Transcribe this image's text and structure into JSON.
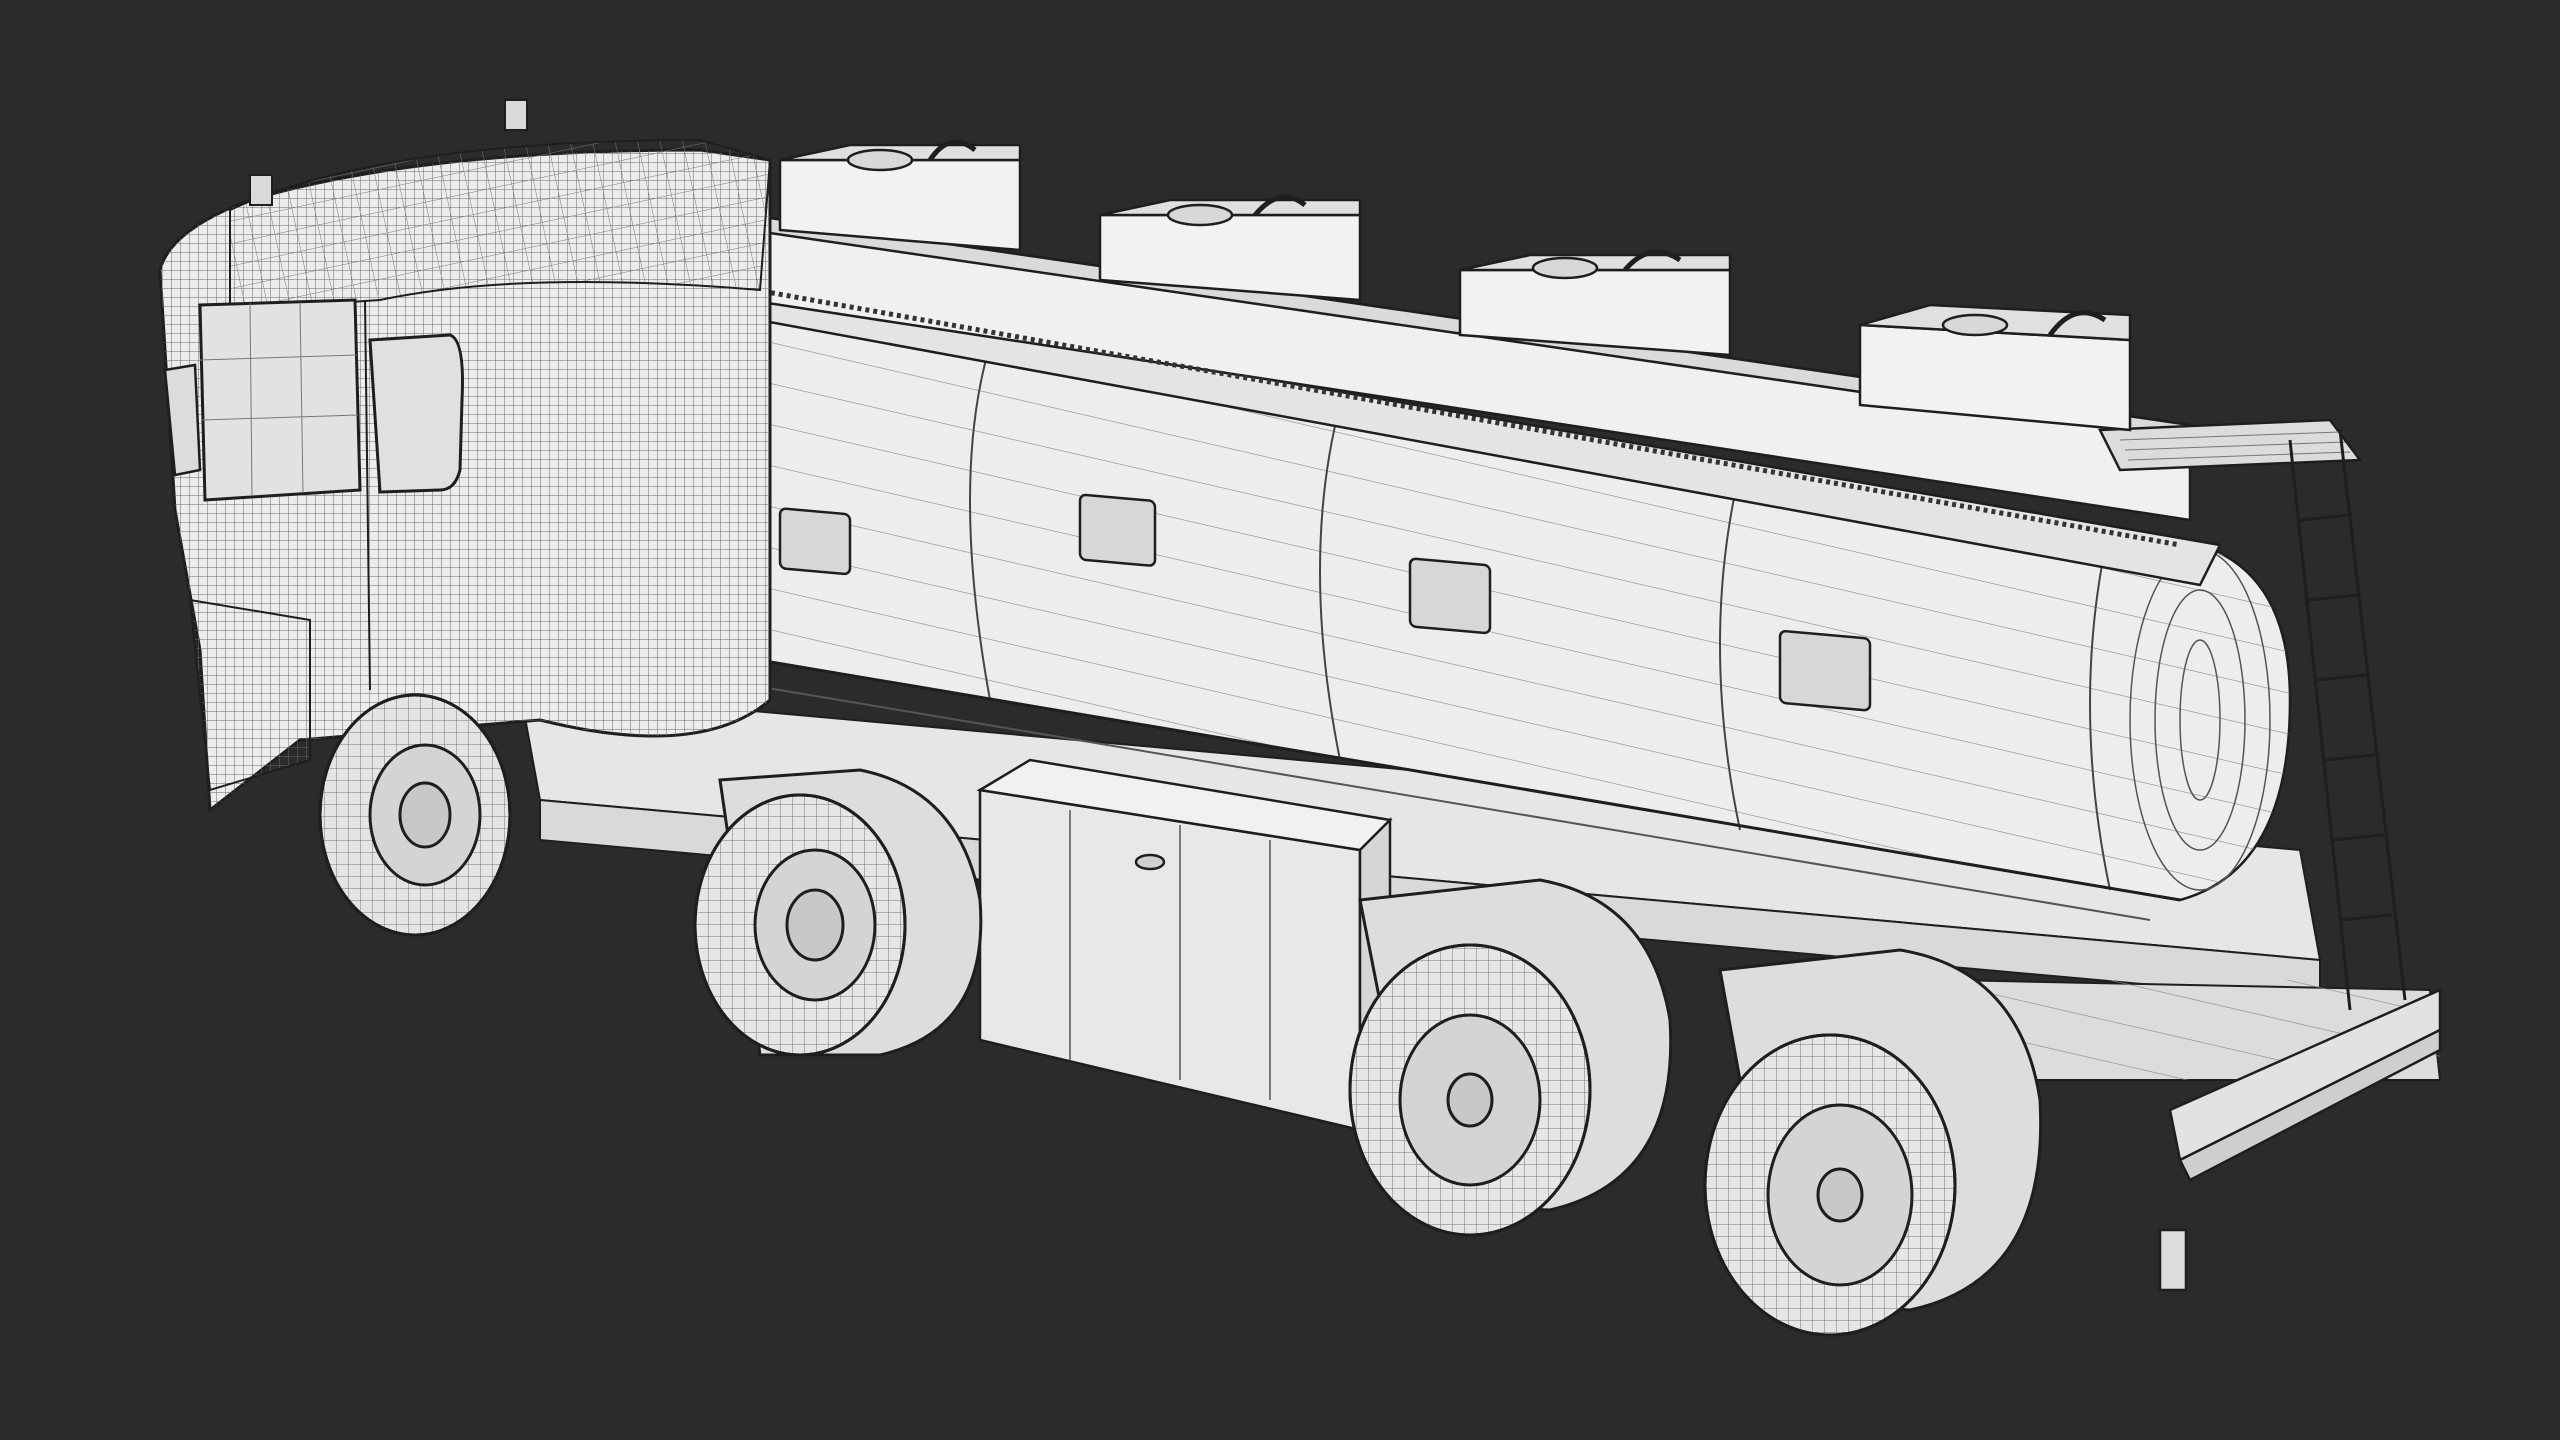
{
  "scene": {
    "subject": "tanker-truck-wireframe",
    "background_color": "#2b2b2b",
    "model_fill_color": "#e9e9e9",
    "wire_color": "#5a5a5a",
    "edge_color": "#1e1e1e",
    "tank_compartments": 4,
    "top_hatches": 4,
    "side_windows": 4,
    "axles": 4,
    "wheels_visible": 4
  }
}
